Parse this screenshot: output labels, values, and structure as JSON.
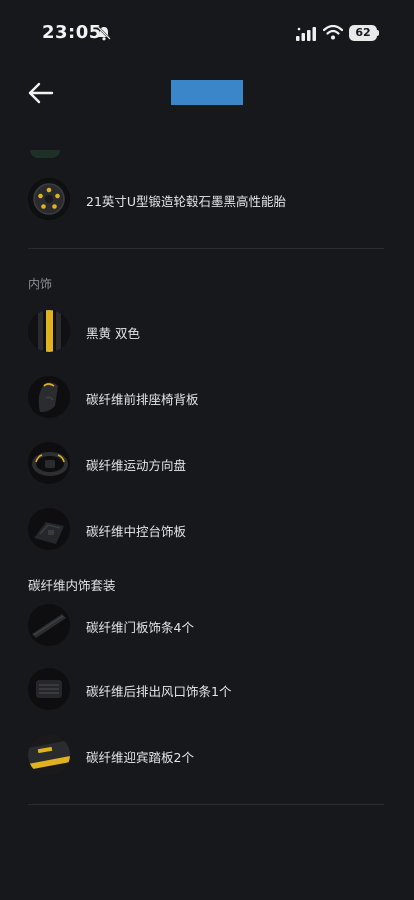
{
  "status_bar": {
    "time": "23:05",
    "battery": "62"
  },
  "nav": {
    "back_icon": "arrow-left-icon"
  },
  "wheels": {
    "item": {
      "label": "21英寸U型锻造轮毂石墨黑高性能胎",
      "icon": "wheel-thumbnail"
    }
  },
  "interior": {
    "section_title": "内饰",
    "items": [
      {
        "label": "黑黄 双色",
        "icon": "color-swatch-thumbnail"
      },
      {
        "label": "碳纤维前排座椅背板",
        "icon": "seat-back-thumbnail"
      },
      {
        "label": "碳纤维运动方向盘",
        "icon": "steering-wheel-thumbnail"
      },
      {
        "label": "碳纤维中控台饰板",
        "icon": "console-thumbnail"
      }
    ]
  },
  "carbon_kit": {
    "title": "碳纤维内饰套装",
    "items": [
      {
        "label": "碳纤维门板饰条4个",
        "icon": "door-trim-thumbnail"
      },
      {
        "label": "碳纤维后排出风口饰条1个",
        "icon": "air-vent-thumbnail"
      },
      {
        "label": "碳纤维迎宾踏板2个",
        "icon": "sill-plate-thumbnail"
      }
    ]
  },
  "colors": {
    "background": "#17181b",
    "accent_yellow": "#e0b21f",
    "title_mask": "#3b86c8"
  }
}
